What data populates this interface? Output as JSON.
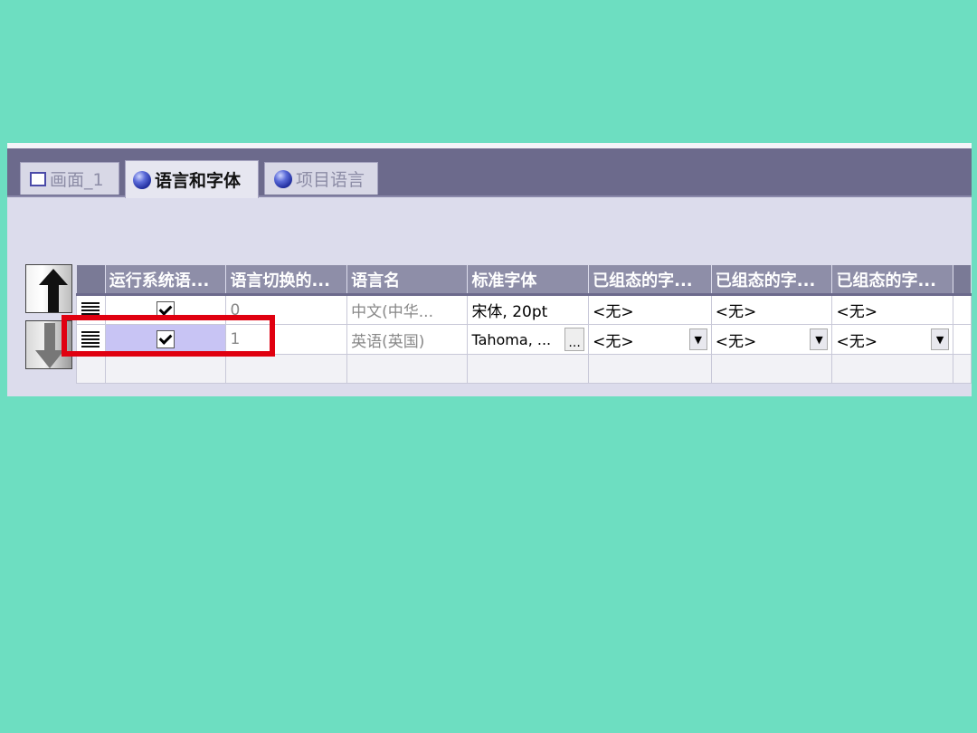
{
  "tabs": [
    {
      "label": "画面_1",
      "icon": "screen-icon",
      "active": false
    },
    {
      "label": "语言和字体",
      "icon": "globe-icon",
      "active": true
    },
    {
      "label": "项目语言",
      "icon": "globe-icon",
      "active": false
    }
  ],
  "table": {
    "columns": [
      "运行系统语...",
      "语言切换的...",
      "语言名",
      "标准字体",
      "已组态的字...",
      "已组态的字...",
      "已组态的字..."
    ],
    "rows": [
      {
        "runtime_checked": true,
        "switch_order": "0",
        "language": "中文(中华...",
        "font": "宋体, 20pt",
        "cfg1": "<无>",
        "cfg2": "<无>",
        "cfg3": "<无>"
      },
      {
        "runtime_checked": true,
        "switch_order": "1",
        "language": "英语(英国)",
        "font": "Tahoma, ...",
        "cfg1": "<无>",
        "cfg2": "<无>",
        "cfg3": "<无>"
      }
    ],
    "font_button_label": "...",
    "dropdown_icon": "▼"
  },
  "colors": {
    "background": "#6ddec1",
    "tab_bar": "#6c6a8c",
    "header": "#8e8ea8",
    "highlight": "#c8c4f4",
    "annotation_box": "#e00010"
  }
}
